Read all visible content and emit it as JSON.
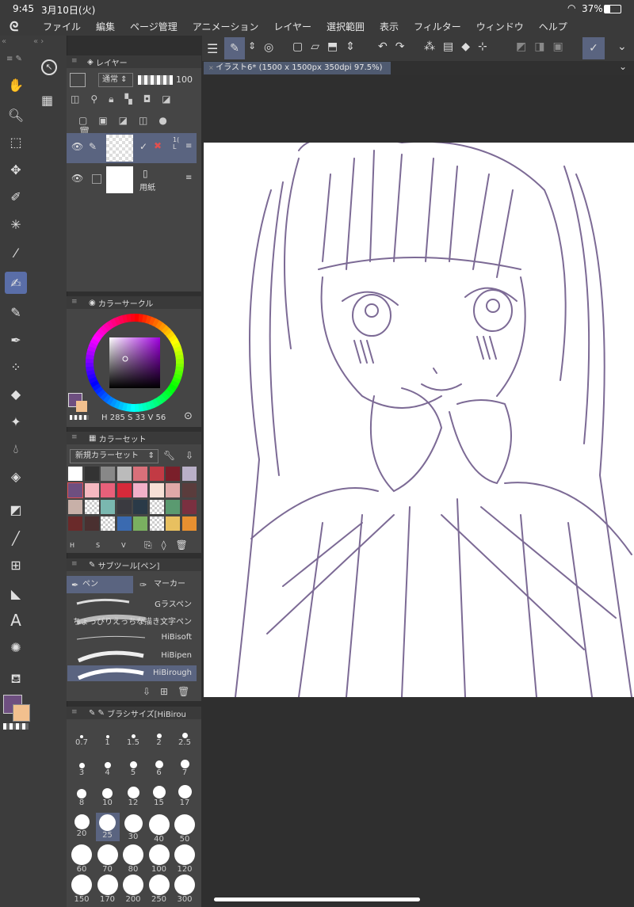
{
  "status": {
    "time": "9:45",
    "date": "3月10日(火)",
    "battery": "37%"
  },
  "menu": [
    "ファイル",
    "編集",
    "ページ管理",
    "アニメーション",
    "レイヤー",
    "選択範囲",
    "表示",
    "フィルター",
    "ウィンドウ",
    "ヘルプ"
  ],
  "layer_panel": {
    "title": "レイヤー",
    "blend_mode": "通常",
    "opacity": "100",
    "layers": [
      {
        "name": "",
        "side_text": "1(\nL",
        "visible": true,
        "selected": true
      },
      {
        "name": "用紙",
        "visible": true,
        "selected": false
      }
    ]
  },
  "color_circle": {
    "title": "カラーサークル",
    "h_label": "H",
    "h": "285",
    "s_label": "S",
    "s": "33",
    "v_label": "V",
    "v": "56",
    "main_color": "#6e4f80",
    "sub_color": "#f2c08e"
  },
  "color_set": {
    "title": "カラーセット",
    "set_name": "新規カラーセット",
    "footer": [
      "H",
      "S",
      "V"
    ],
    "swatches": [
      "#ffffff",
      "#333333",
      "#888888",
      "#bbbbbb",
      "#d9707a",
      "#c23a44",
      "#7a1f2a",
      "#b9b0c8",
      "#6e4f80",
      "#f5b8c0",
      "#e8607a",
      "#d62a3a",
      "#f2b0c8",
      "#f7e0d6",
      "#e0a8a8",
      "#5a3c3c",
      "#c8b0a8",
      "#checker",
      "#7ab8b0",
      "#3a3a40",
      "#2a3a48",
      "#checker",
      "#5a9a70",
      "#7a3040",
      "#6a2a2a",
      "#4a3030",
      "#checker",
      "#3a6ab0",
      "#7ab060",
      "#checker",
      "#e8c060",
      "#e89030"
    ]
  },
  "subtool": {
    "title": "サブツール[ペン]",
    "tabs": [
      "ペン",
      "マーカー"
    ],
    "brushes": [
      "Gラスペン",
      "ちょっぴりえっちな描き文字ペン",
      "HiBisoft",
      "HiBipen",
      "HiBirough"
    ],
    "selected": "HiBirough"
  },
  "brush_size": {
    "title": "ブラシサイズ[HiBirou",
    "sizes": [
      "0.7",
      "1",
      "1.5",
      "2",
      "2.5",
      "3",
      "4",
      "5",
      "6",
      "7",
      "8",
      "10",
      "12",
      "15",
      "17",
      "20",
      "25",
      "30",
      "40",
      "50",
      "60",
      "70",
      "80",
      "100",
      "120",
      "150",
      "170",
      "200",
      "250",
      "300"
    ],
    "selected": "25"
  },
  "document": {
    "tab_title": "イラスト6* (1500 x 1500px 350dpi 97.5%)"
  },
  "tools": [
    "hand-icon",
    "zoom-icon",
    "move-icon",
    "transform-icon",
    "selection-icon",
    "magic-wand-icon",
    "eyedropper-icon",
    "pen-icon",
    "pencil-icon",
    "brush-icon",
    "airbrush-icon",
    "fill-icon",
    "decoration-icon",
    "blend-icon",
    "eraser-icon",
    "gradient-icon",
    "line-icon",
    "frame-icon",
    "ruler-icon",
    "text-icon",
    "star-icon",
    "bucket-icon"
  ]
}
